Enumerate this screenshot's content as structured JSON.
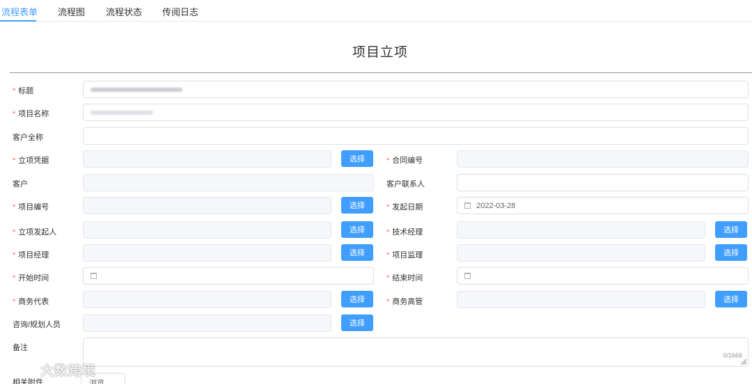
{
  "tabs": [
    {
      "label": "流程表单",
      "active": true
    },
    {
      "label": "流程图",
      "active": false
    },
    {
      "label": "流程状态",
      "active": false
    },
    {
      "label": "传阅日志",
      "active": false
    }
  ],
  "form": {
    "title": "项目立项",
    "fields": {
      "title": {
        "label": "标题",
        "required": true
      },
      "project_name": {
        "label": "项目名称",
        "required": true
      },
      "customer_full_name": {
        "label": "客户全称",
        "required": false,
        "value": ""
      },
      "basis": {
        "label": "立项凭据",
        "required": true,
        "value": ""
      },
      "contract_no": {
        "label": "合同编号",
        "required": true,
        "value": ""
      },
      "customer": {
        "label": "客户",
        "required": false,
        "value": ""
      },
      "customer_contact": {
        "label": "客户联系人",
        "required": false,
        "value": ""
      },
      "project_no": {
        "label": "项目编号",
        "required": true,
        "value": ""
      },
      "start_date": {
        "label": "发起日期",
        "required": true,
        "value": "2022-03-28"
      },
      "initiator": {
        "label": "立项发起人",
        "required": true,
        "value": ""
      },
      "tech_manager": {
        "label": "技术经理",
        "required": true,
        "value": ""
      },
      "project_manager": {
        "label": "项目经理",
        "required": true,
        "value": ""
      },
      "project_supervisor": {
        "label": "项目监理",
        "required": true,
        "value": ""
      },
      "begin_time": {
        "label": "开始时间",
        "required": true,
        "value": ""
      },
      "end_time": {
        "label": "结束时间",
        "required": true,
        "value": ""
      },
      "business_rep": {
        "label": "商务代表",
        "required": true,
        "value": ""
      },
      "business_exec": {
        "label": "商务高管",
        "required": true,
        "value": ""
      },
      "consultant": {
        "label": "咨询/规划人员",
        "required": false,
        "value": ""
      },
      "remark": {
        "label": "备注",
        "required": false,
        "value": "",
        "counter": "0/1666"
      },
      "attachment": {
        "label": "相关附件",
        "required": false
      }
    },
    "select_button_label": "选择",
    "browse_button_label": "浏览..."
  },
  "watermark": {
    "text": "大数跨境"
  },
  "icons": {
    "date": "calendar-icon",
    "required": "asterisk"
  },
  "colors": {
    "primary": "#409eff",
    "required": "#f56c6c",
    "disabled_bg": "#f5f7fa",
    "border": "#dcdfe6"
  }
}
